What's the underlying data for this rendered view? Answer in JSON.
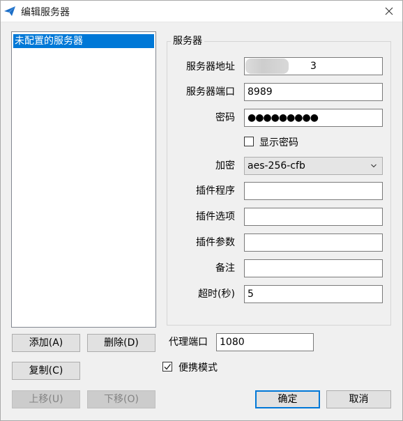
{
  "window": {
    "title": "编辑服务器",
    "close_icon": "close-icon",
    "app_icon": "paper-plane-icon",
    "accent": "#0078d7"
  },
  "server_list": {
    "items": [
      "未配置的服务器"
    ],
    "selected_index": 0
  },
  "server_group": {
    "label": "服务器",
    "address_label": "服务器地址",
    "address_value": "3",
    "port_label": "服务器端口",
    "port_value": "8989",
    "password_label": "密码",
    "password_value": "●●●●●●●●●",
    "show_password_label": "显示密码",
    "show_password_checked": false,
    "encryption_label": "加密",
    "encryption_value": "aes-256-cfb",
    "plugin_program_label": "插件程序",
    "plugin_program_value": "",
    "plugin_options_label": "插件选项",
    "plugin_options_value": "",
    "plugin_args_label": "插件参数",
    "plugin_args_value": "",
    "remarks_label": "备注",
    "remarks_value": "",
    "timeout_label": "超时(秒)",
    "timeout_value": "5"
  },
  "buttons": {
    "add": "添加(A)",
    "delete": "删除(D)",
    "copy": "复制(C)",
    "move_up": "上移(U)",
    "move_down": "下移(O)",
    "ok": "确定",
    "cancel": "取消"
  },
  "proxy": {
    "port_label": "代理端口",
    "port_value": "1080"
  },
  "portable": {
    "label": "便携模式",
    "checked": true
  }
}
